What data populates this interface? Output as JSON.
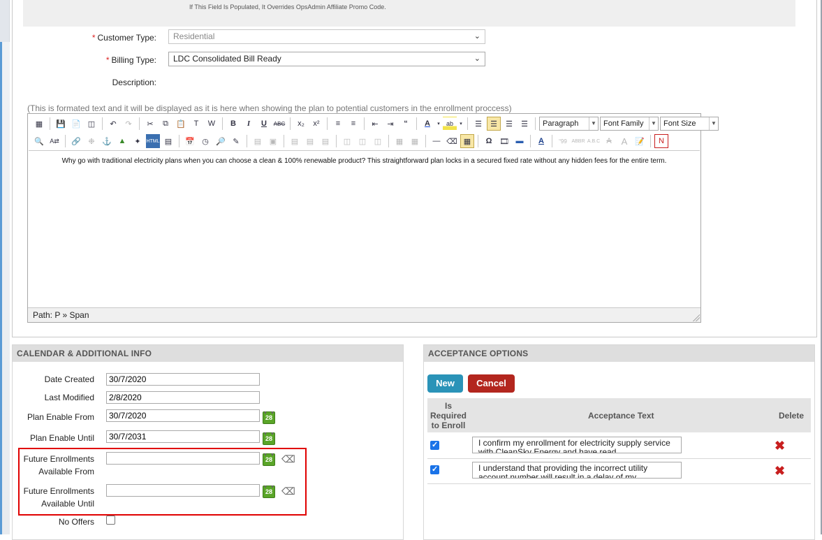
{
  "helper_text": "If This Field Is Populated, It Overrides OpsAdmin Affiliate Promo Code.",
  "customer_type": {
    "label": "Customer Type:",
    "value": "Residential"
  },
  "billing_type": {
    "label": "Billing Type:",
    "value": "LDC Consolidated Bill Ready"
  },
  "description_label": "Description:",
  "editor_note": "(This is formated text and it will be displayed as it is here when showing the plan to potential customers in the enrollment proccess)",
  "editor": {
    "format_select": "Paragraph",
    "font_family_select": "Font Family",
    "font_size_select": "Font Size",
    "content": "Why go with traditional electricity plans when you can choose a clean & 100% renewable product? This straightforward plan locks in a secured fixed rate without any hidden fees for the entire term.",
    "path": "Path: P » Span"
  },
  "calendar_panel": {
    "title": "CALENDAR & ADDITIONAL INFO",
    "date_created_label": "Date Created",
    "date_created": "30/7/2020",
    "last_modified_label": "Last Modified",
    "last_modified": "2/8/2020",
    "plan_enable_from_label": "Plan Enable From",
    "plan_enable_from": "30/7/2020",
    "plan_enable_until_label": "Plan Enable Until",
    "plan_enable_until": "30/7/2031",
    "future_from_label_1": "Future Enrollments",
    "future_from_label_2": "Available From",
    "future_from": "",
    "future_until_label_1": "Future Enrollments",
    "future_until_label_2": "Available Until",
    "future_until": "",
    "no_offers_label": "No Offers",
    "calendar_day": "28"
  },
  "acceptance_panel": {
    "title": "ACCEPTANCE OPTIONS",
    "new_label": "New",
    "cancel_label": "Cancel",
    "col_required_1": "Is",
    "col_required_2": "Required",
    "col_required_3": "to Enroll",
    "col_text": "Acceptance Text",
    "col_delete": "Delete",
    "rows": [
      {
        "required": true,
        "text": "I confirm my enrollment for electricity supply service with CleanSky Energy and have read"
      },
      {
        "required": true,
        "text": "I understand that providing the incorrect utility account number will result in a delay of my"
      }
    ]
  },
  "colors": {
    "accent_new": "#2a93b8",
    "accent_cancel": "#b3261e",
    "highlight_border": "#e00000"
  }
}
